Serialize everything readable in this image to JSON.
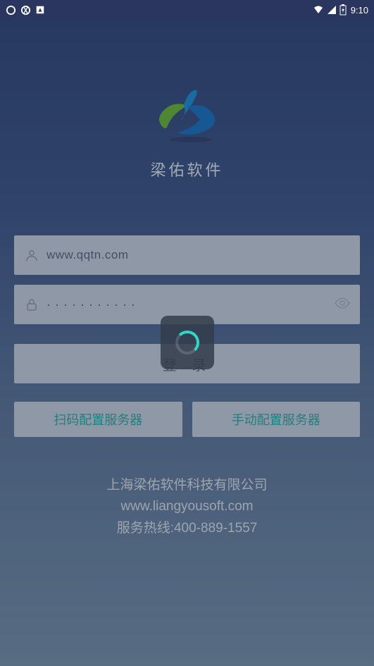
{
  "status": {
    "time": "9:10"
  },
  "app": {
    "name": "梁佑软件"
  },
  "form": {
    "username_value": "www.qqtn.com",
    "password_value": "···········",
    "login_label": "登 录"
  },
  "config": {
    "scan_label": "扫码配置服务器",
    "manual_label": "手动配置服务器"
  },
  "footer": {
    "company": "上海梁佑软件科技有限公司",
    "website": "www.liangyousoft.com",
    "hotline": "服务热线:400-889-1557"
  }
}
